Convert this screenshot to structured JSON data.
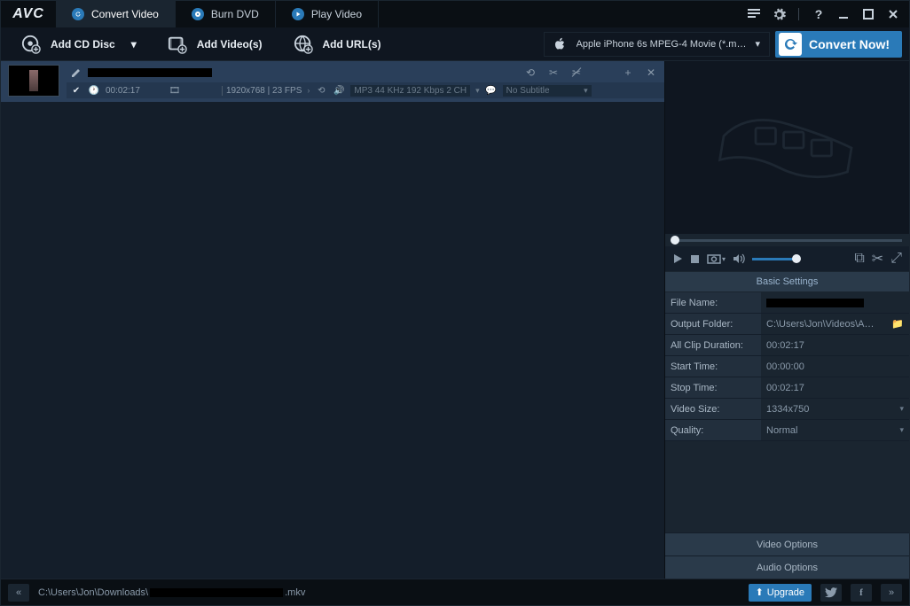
{
  "app": {
    "logo": "AVC"
  },
  "tabs": {
    "convert": "Convert Video",
    "burn": "Burn DVD",
    "play": "Play Video"
  },
  "toolbar": {
    "add_cd": "Add CD Disc",
    "add_videos": "Add Video(s)",
    "add_urls": "Add URL(s)",
    "profile": "Apple iPhone 6s MPEG-4 Movie (*.m…",
    "convert_label": "Convert Now!"
  },
  "file": {
    "duration": "00:02:17",
    "resolution_fps": "1920x768 | 23 FPS",
    "audio_info": "MP3 44 KHz 192 Kbps 2 CH",
    "subtitle": "No Subtitle"
  },
  "sidebar": {
    "basic_header": "Basic Settings",
    "rows": {
      "file_name_label": "File Name:",
      "output_folder_label": "Output Folder:",
      "output_folder_value": "C:\\Users\\Jon\\Videos\\A…",
      "all_clip_label": "All Clip Duration:",
      "all_clip_value": "00:02:17",
      "start_time_label": "Start Time:",
      "start_time_value": "00:00:00",
      "stop_time_label": "Stop Time:",
      "stop_time_value": "00:02:17",
      "video_size_label": "Video Size:",
      "video_size_value": "1334x750",
      "quality_label": "Quality:",
      "quality_value": "Normal"
    },
    "video_options": "Video Options",
    "audio_options": "Audio Options"
  },
  "statusbar": {
    "path_prefix": "C:\\Users\\Jon\\Downloads\\",
    "path_suffix": ".mkv",
    "upgrade": "Upgrade"
  }
}
